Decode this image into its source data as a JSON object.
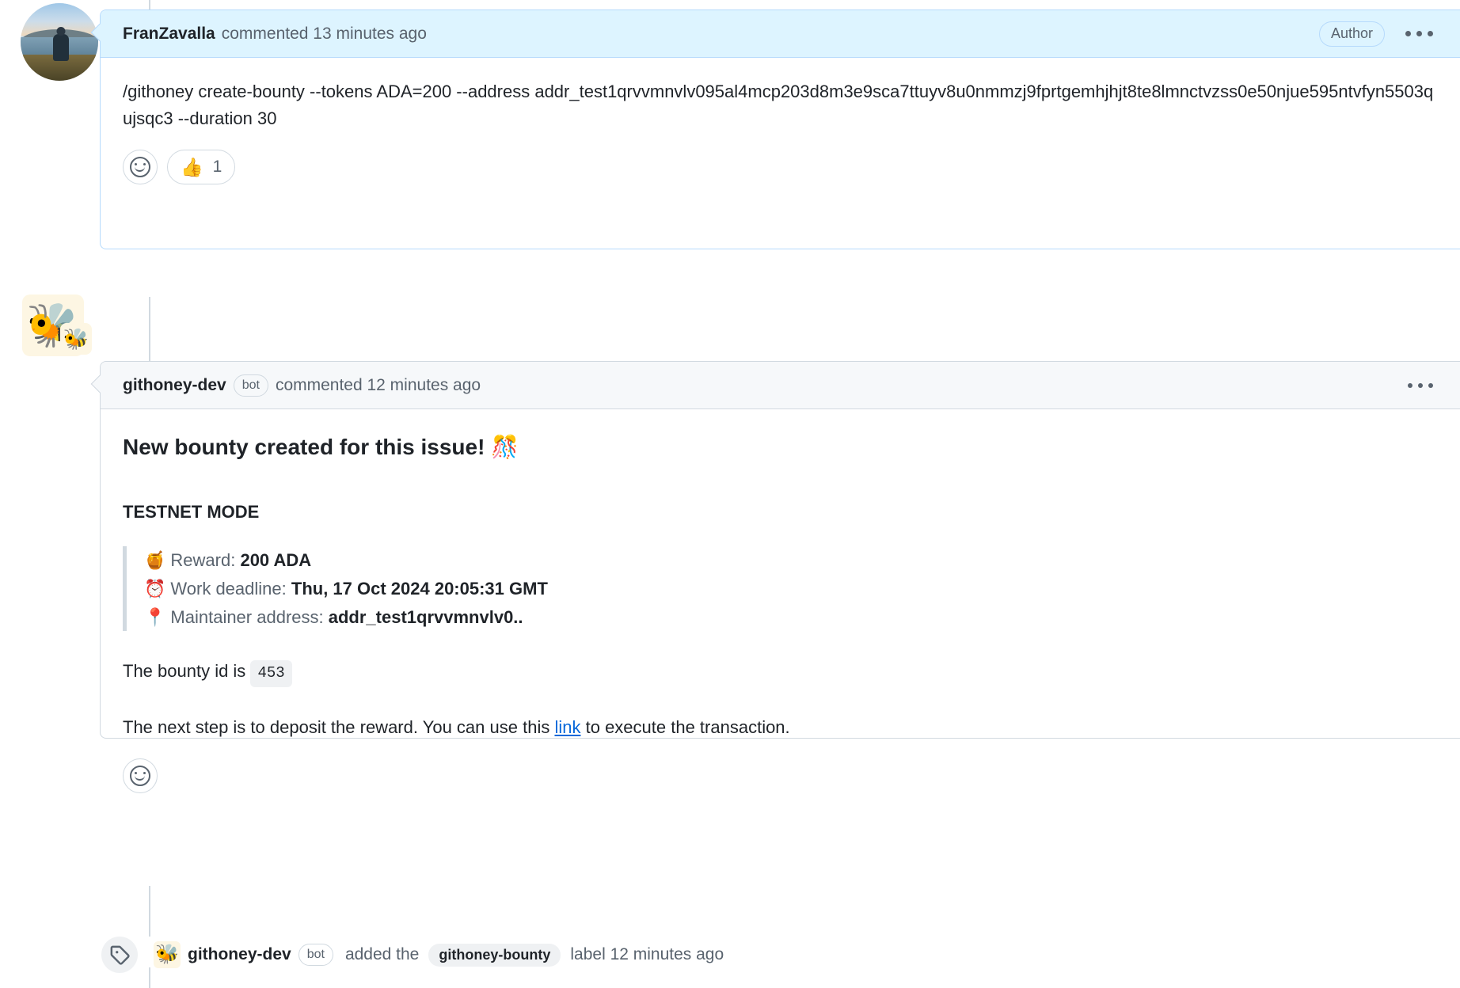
{
  "colors": {
    "author_comment_bg": "#ddf4ff",
    "author_comment_border": "#b6dafc",
    "bot_comment_bg": "#f6f8fa",
    "border": "#d1d9e0",
    "link": "#0969da",
    "muted_text": "#59636e",
    "text": "#1f2328",
    "bee_avatar_bg": "#fdf6e3"
  },
  "comments": [
    {
      "author": "FranZavalla",
      "meta": "commented 13 minutes ago",
      "author_badge": "Author",
      "body": "/githoney create-bounty --tokens ADA=200 --address addr_test1qrvvmnvlv095al4mcp203d8m3e9sca7ttuyv8u0nmmzj9fprtgemhjhjt8te8lmnctvzss0e50njue595ntvfyn5503qujsqc3 --duration 30",
      "reactions": {
        "add_label": "Add reaction",
        "thumbs_emoji": "👍",
        "thumbs_count": "1"
      }
    },
    {
      "author": "githoney-dev",
      "bot_badge": "bot",
      "meta": "commented 12 minutes ago",
      "avatar_emoji": "🐝",
      "heading": "New bounty created for this issue! 🎊",
      "mode_line": "TESTNET MODE",
      "quote": [
        {
          "emoji": "🍯",
          "label": "Reward:",
          "value": "200 ADA"
        },
        {
          "emoji": "⏰",
          "label": "Work deadline:",
          "value": "Thu, 17 Oct 2024 20:05:31 GMT"
        },
        {
          "emoji": "📍",
          "label": "Maintainer address:",
          "value": "addr_test1qrvvmnvlv0.."
        }
      ],
      "bounty_id_prefix": "The bounty id is",
      "bounty_id": "453",
      "next_step_prefix": "The next step is to deposit the reward. You can use this",
      "next_step_link": "link",
      "next_step_suffix": "to execute the transaction.",
      "reactions": {
        "add_label": "Add reaction"
      }
    }
  ],
  "event": {
    "actor": "githoney-dev",
    "bot_badge": "bot",
    "avatar_emoji": "🐝",
    "action": "added the",
    "label": "githoney-bounty",
    "suffix": "label 12 minutes ago"
  }
}
